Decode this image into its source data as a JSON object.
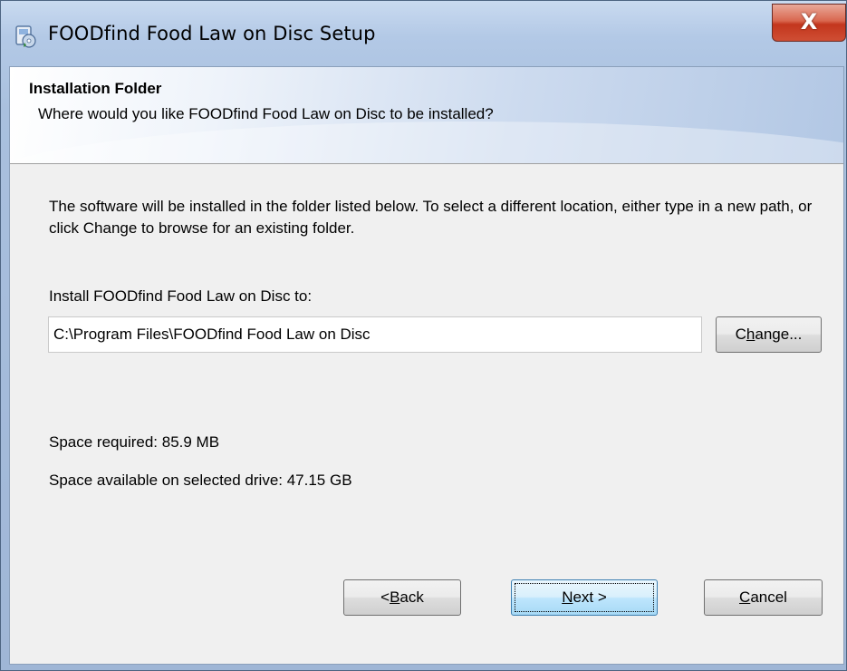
{
  "window": {
    "title": "FOODfind Food Law on Disc Setup",
    "close_label": "X"
  },
  "banner": {
    "title": "Installation Folder",
    "subtitle": "Where would you like FOODfind Food Law on Disc to be installed?"
  },
  "body": {
    "description": "The software will be installed in the folder listed below. To select a different location, either type in a new path, or click Change to browse for an existing folder.",
    "path_label": "Install FOODfind Food Law on Disc to:",
    "path_value": "C:\\Program Files\\FOODfind Food Law on Disc",
    "space_required": "Space required: 85.9 MB",
    "space_available": "Space available on selected drive: 47.15 GB"
  },
  "buttons": {
    "change": {
      "pre": "C",
      "key": "h",
      "post": "ange..."
    },
    "back": {
      "pre": "< ",
      "key": "B",
      "post": "ack"
    },
    "next": {
      "pre": "",
      "key": "N",
      "post": "ext >"
    },
    "cancel": {
      "pre": "",
      "key": "C",
      "post": "ancel"
    }
  },
  "icons": {
    "title_icon": "setup-disc-icon",
    "close_icon": "close-icon"
  }
}
